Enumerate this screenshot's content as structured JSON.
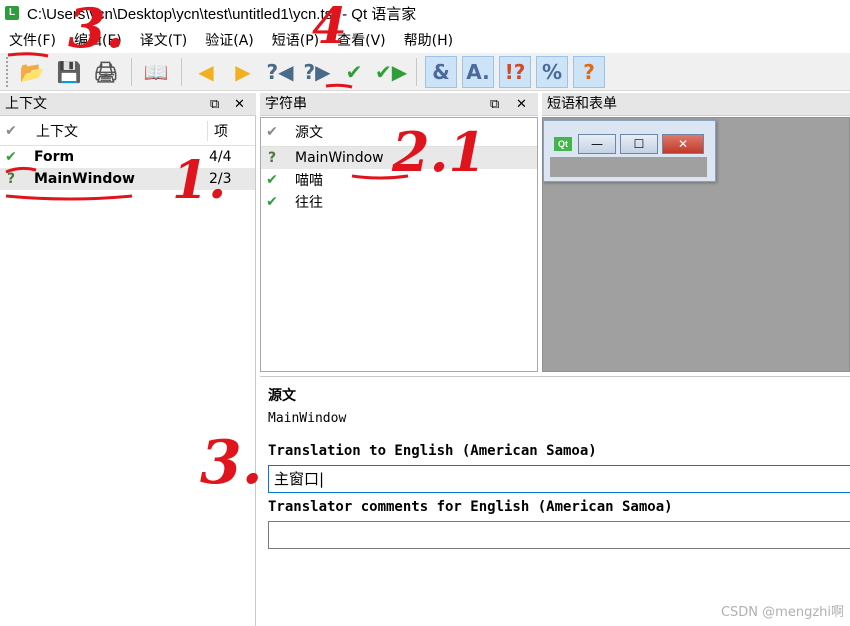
{
  "window": {
    "app_icon": "L",
    "title": "C:\\Users\\ycn\\Desktop\\ycn\\test\\untitled1\\ycn.ts* - Qt 语言家"
  },
  "menu": [
    {
      "label": "文件(F)"
    },
    {
      "label": "编辑(E)"
    },
    {
      "label": "译文(T)"
    },
    {
      "label": "验证(A)"
    },
    {
      "label": "短语(P)"
    },
    {
      "label": "查看(V)"
    },
    {
      "label": "帮助(H)"
    }
  ],
  "toolbar": [
    {
      "icon": "open-folder-icon",
      "glyph": "📂",
      "color": "#d89a2a",
      "pressed": false
    },
    {
      "icon": "save-icon",
      "glyph": "💾",
      "color": "#2b66b3",
      "pressed": false
    },
    {
      "icon": "print-icon",
      "glyph": "🖨",
      "color": "#555555",
      "pressed": false
    },
    {
      "icon": "phrasebook-icon",
      "glyph": "📖",
      "color": "#8a5a2a",
      "pressed": false
    },
    {
      "icon": "prev-icon",
      "glyph": "◀",
      "color": "#f0b020",
      "pressed": false
    },
    {
      "icon": "next-icon",
      "glyph": "▶",
      "color": "#f0b020",
      "pressed": false
    },
    {
      "icon": "prev-unfinished-icon",
      "glyph": "?◀",
      "color": "#4a6a8a",
      "pressed": false
    },
    {
      "icon": "next-unfinished-icon",
      "glyph": "?▶",
      "color": "#4a6a8a",
      "pressed": false
    },
    {
      "icon": "done-icon",
      "glyph": "✔",
      "color": "#2e9e3a",
      "pressed": false
    },
    {
      "icon": "done-next-icon",
      "glyph": "✔▶",
      "color": "#2e9e3a",
      "pressed": false
    },
    {
      "icon": "accelerators-icon",
      "glyph": "&",
      "color": "#4a6a9a",
      "pressed": true
    },
    {
      "icon": "ending-punctuation-icon",
      "glyph": "A.",
      "color": "#4a6a9a",
      "pressed": true
    },
    {
      "icon": "phrase-matches-icon",
      "glyph": "!?",
      "color": "#d04a2a",
      "pressed": true
    },
    {
      "icon": "place-markers-icon",
      "glyph": "%",
      "color": "#4a6a9a",
      "pressed": true
    },
    {
      "icon": "what-is-this-icon",
      "glyph": "?",
      "color": "#e06a10",
      "pressed": true
    }
  ],
  "context_panel": {
    "title": "上下文",
    "float_icon": "⧉",
    "close_icon": "✕",
    "header": {
      "icon": "✔",
      "context": "上下文",
      "items": "项"
    },
    "rows": [
      {
        "icon": "✔",
        "status": "ok",
        "name": "Form",
        "items": "4/4",
        "selected": false
      },
      {
        "icon": "?",
        "status": "q",
        "name": "MainWindow",
        "items": "2/3",
        "selected": true
      }
    ]
  },
  "strings_panel": {
    "title": "字符串",
    "float_icon": "⧉",
    "close_icon": "✕",
    "header": {
      "icon": "✔",
      "source": "源文"
    },
    "rows": [
      {
        "icon": "?",
        "status": "q",
        "text": "MainWindow",
        "selected": true
      },
      {
        "icon": "✔",
        "status": "ok",
        "text": "喵喵",
        "selected": false
      },
      {
        "icon": "✔",
        "status": "ok",
        "text": "往往",
        "selected": false
      }
    ]
  },
  "forms_panel": {
    "title": "短语和表单",
    "logo": "Qt",
    "minimize": "—",
    "maximize": "☐",
    "close": "✕"
  },
  "editor": {
    "source_label": "源文",
    "source_text": "MainWindow",
    "translation_label": "Translation to English (American Samoa)",
    "translation_value": "主窗口|",
    "comments_label": "Translator comments for English (American Samoa)",
    "comments_value": ""
  },
  "annotations": [
    "3.",
    "4",
    "1.",
    "2.1",
    "3."
  ],
  "watermark": "CSDN @mengzhi啊"
}
